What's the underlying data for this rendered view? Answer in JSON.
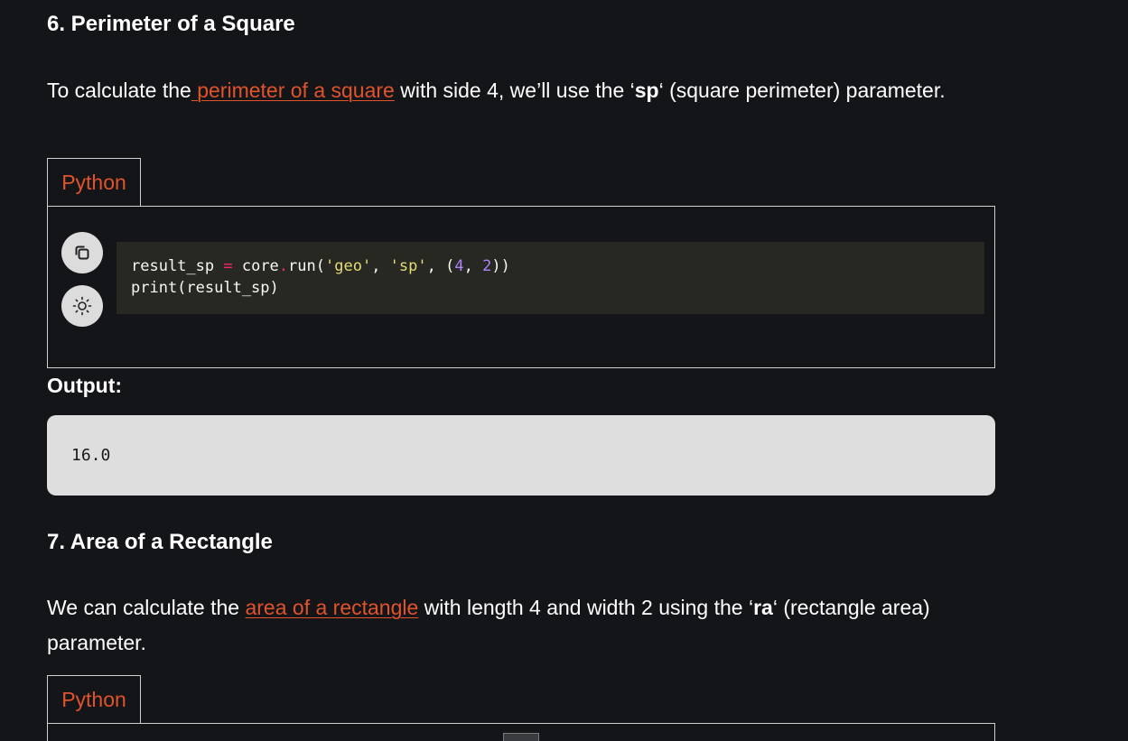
{
  "section6": {
    "heading": "6. Perimeter of a Square",
    "para": {
      "before": "To calculate the",
      "link": " perimeter of a square",
      "mid": " with side 4, we’ll use the ‘",
      "bold": "sp",
      "after": "‘ (square perimeter) parameter."
    },
    "tab_label": "Python",
    "code": {
      "line1": {
        "var": "result_sp ",
        "eq": "=",
        "obj": " core",
        "dot": ".",
        "call": "run(",
        "s1": "'geo'",
        "c1": ", ",
        "s2": "'sp'",
        "c2": ", (",
        "n1": "4",
        "c3": ", ",
        "n2": "2",
        "end": "))"
      },
      "line2": "print(result_sp)"
    },
    "output_label": "Output:",
    "output_value": "16.0"
  },
  "section7": {
    "heading": "7. Area of a Rectangle",
    "para": {
      "before": "We can calculate the ",
      "link": "area of a rectangle",
      "mid": " with length 4 and width 2 using the ‘",
      "bold": "ra",
      "after": "‘ (rectangle area) parameter."
    },
    "tab_label": "Python"
  },
  "icons": {
    "copy": "copy-icon",
    "theme": "sun-icon"
  },
  "colors": {
    "background": "#141518",
    "link": "#e0532b",
    "code_bg": "#272822",
    "output_bg": "#dedede"
  }
}
